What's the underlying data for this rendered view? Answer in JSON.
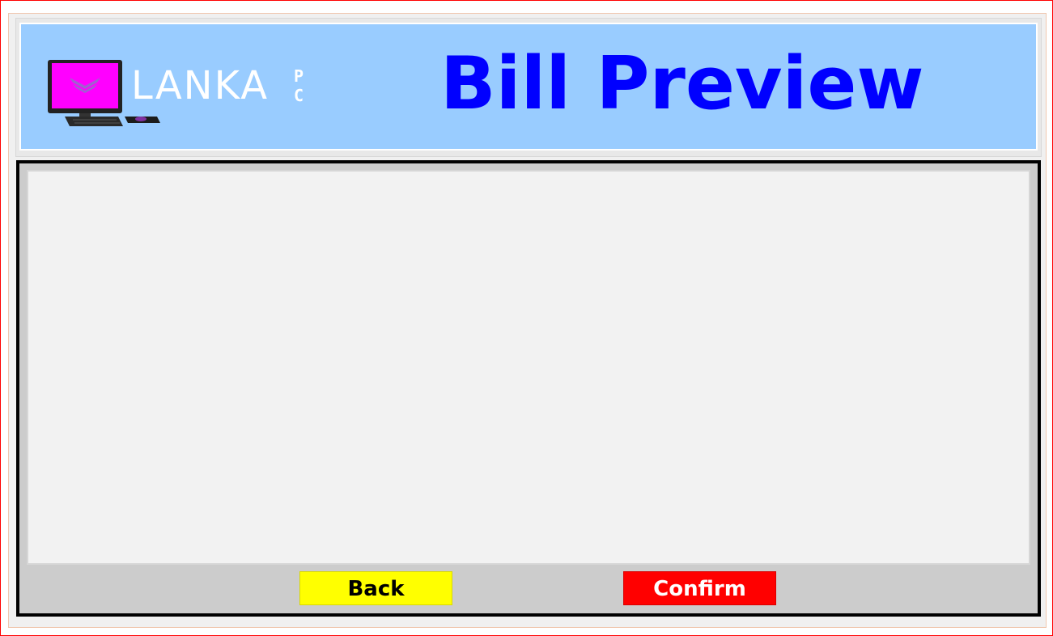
{
  "header": {
    "logo": {
      "word": "LANKA",
      "suffix_top": "P",
      "suffix_bottom": "C",
      "icon": "computer-monitor-icon"
    },
    "title": "Bill Preview"
  },
  "preview": {
    "content": ""
  },
  "actions": {
    "back_label": "Back",
    "confirm_label": "Confirm"
  },
  "colors": {
    "header_background": "#99ccff",
    "title": "#0000ff",
    "back_button": "#ffff00",
    "confirm_button": "#ff0000",
    "window_border": "#ff0000",
    "screen_magenta": "#ff00ff"
  }
}
